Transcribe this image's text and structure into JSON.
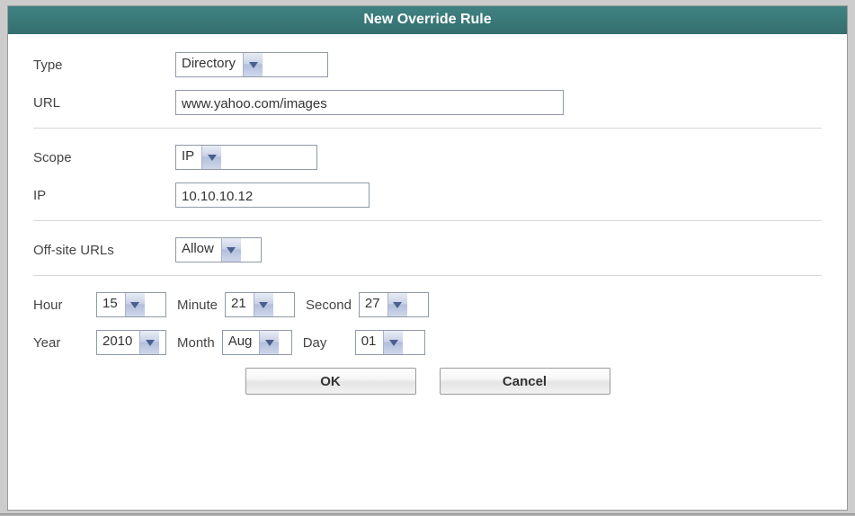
{
  "window": {
    "title": "New Override Rule"
  },
  "labels": {
    "type": "Type",
    "url": "URL",
    "scope": "Scope",
    "ip": "IP",
    "offsite": "Off-site URLs",
    "hour": "Hour",
    "minute": "Minute",
    "second": "Second",
    "year": "Year",
    "month": "Month",
    "day": "Day"
  },
  "fields": {
    "type": "Directory",
    "url": "www.yahoo.com/images",
    "scope": "IP",
    "ip": "10.10.10.12",
    "offsite": "Allow",
    "hour": "15",
    "minute": "21",
    "second": "27",
    "year": "2010",
    "month": "Aug",
    "day": "01"
  },
  "buttons": {
    "ok": "OK",
    "cancel": "Cancel"
  }
}
